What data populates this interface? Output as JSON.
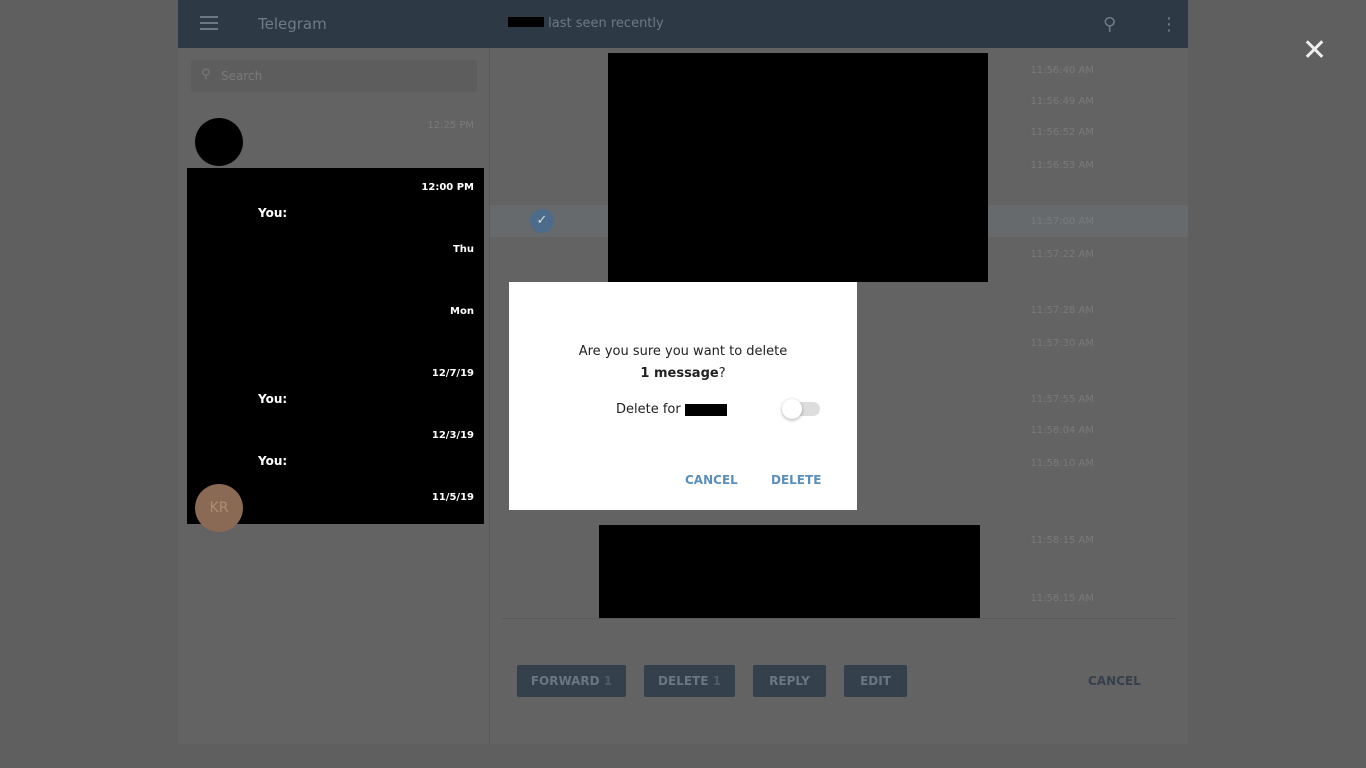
{
  "header": {
    "title": "Telegram",
    "peer_status": "last seen recently"
  },
  "search": {
    "placeholder": "Search"
  },
  "chats": [
    {
      "time": "12:25 PM",
      "preview": ""
    },
    {
      "time": "12:00 PM",
      "preview": "You:"
    },
    {
      "time": "Thu",
      "preview": ""
    },
    {
      "time": "Mon",
      "preview": ""
    },
    {
      "time": "12/7/19",
      "preview": "You:"
    },
    {
      "time": "12/3/19",
      "preview": "You:"
    },
    {
      "time": "11/5/19",
      "preview": "",
      "avatar_initials": "KR"
    }
  ],
  "message_times": [
    "11:56:40 AM",
    "11:56:49 AM",
    "11:56:52 AM",
    "11:56:53 AM",
    "11:57:00 AM",
    "11:57:22 AM",
    "11:57:28 AM",
    "11:57:30 AM",
    "11:57:55 AM",
    "11:58:04 AM",
    "11:58:10 AM",
    "11:58:15 AM",
    "11:58:15 AM"
  ],
  "selection_bar": {
    "forward": "FORWARD",
    "delete": "DELETE",
    "count": "1",
    "reply": "REPLY",
    "edit": "EDIT",
    "cancel": "CANCEL"
  },
  "dialog": {
    "question": "Are you sure you want to delete",
    "count_text": "1 message",
    "question_end": "?",
    "delete_for": "Delete for",
    "delete_for_all": false,
    "cancel": "CANCEL",
    "delete": "DELETE"
  },
  "colors": {
    "accent": "#5a8fbb",
    "header": "#2d3944"
  }
}
